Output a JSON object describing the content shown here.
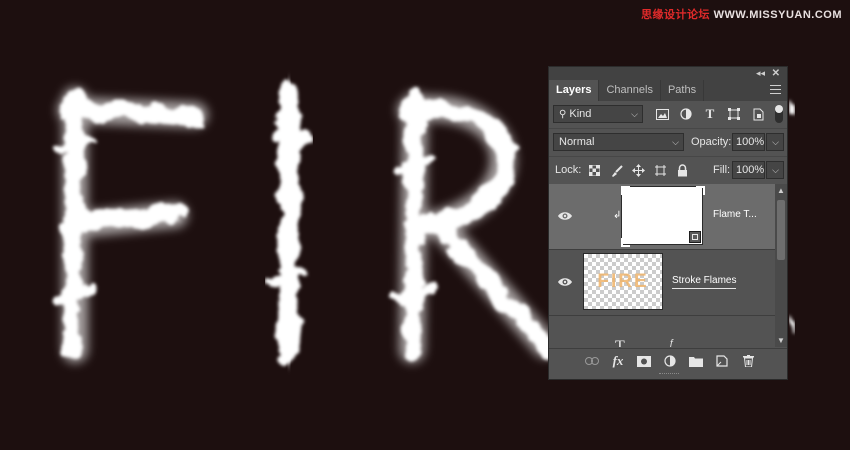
{
  "watermark": {
    "text_red": "思缘设计论坛",
    "text_white": " WWW.MISSYUAN.COM"
  },
  "canvas": {
    "visible_letters": [
      "F",
      "I",
      "R"
    ]
  },
  "panel": {
    "tabs": [
      {
        "label": "Layers",
        "active": true
      },
      {
        "label": "Channels",
        "active": false
      },
      {
        "label": "Paths",
        "active": false
      }
    ],
    "filter": {
      "kind_label": "Kind"
    },
    "blend": {
      "mode": "Normal",
      "opacity_label": "Opacity:",
      "opacity": "100%"
    },
    "lock": {
      "label": "Lock:",
      "fill_label": "Fill:",
      "fill": "100%"
    },
    "layers": [
      {
        "name": "Flame T...",
        "selected": true,
        "thumb": "white",
        "clipped": true,
        "smart_object": true
      },
      {
        "name": "Stroke Flames",
        "selected": false,
        "thumb_text": "FIRE"
      },
      {
        "name": "",
        "selected": false,
        "type_layer": true
      }
    ]
  },
  "colors": {
    "background": "#1d0f0f",
    "panel": "#535353",
    "selected_layer": "#6c6c6c",
    "thumb_text": "#f0b46a"
  }
}
